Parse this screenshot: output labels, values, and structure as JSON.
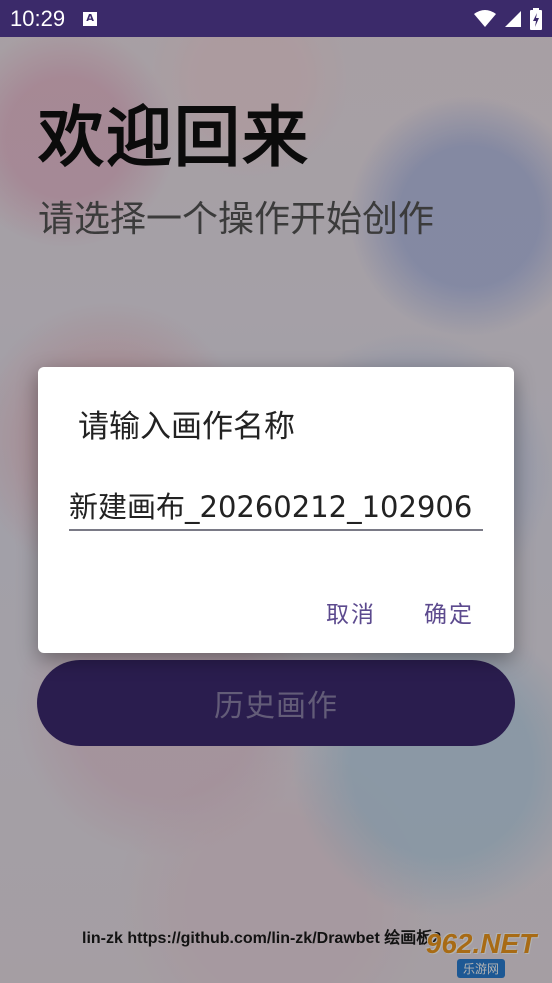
{
  "status_bar": {
    "time": "10:29",
    "notification_icon": "a-letter-icon",
    "icons": [
      "wifi-icon",
      "cellular-icon",
      "battery-charging-icon"
    ],
    "color": "#3b2a6a"
  },
  "main": {
    "welcome_title": "欢迎回来",
    "subtitle": "请选择一个操作开始创作",
    "history_button_label": "历史画作",
    "button_color": "#3d2a70"
  },
  "footer": {
    "credit": "lin-zk https://github.com/lin-zk/Drawbet 绘画板2",
    "watermark_main": "962.NET",
    "watermark_sub": "乐游网"
  },
  "dialog": {
    "title": "请输入画作名称",
    "input_value": "新建画布_20260212_102906",
    "cancel_label": "取消",
    "confirm_label": "确定",
    "accent_color": "#5c4a8e"
  }
}
